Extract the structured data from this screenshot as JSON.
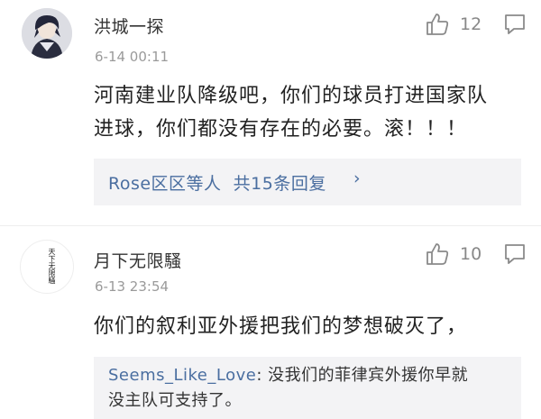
{
  "comments": [
    {
      "username": "洪城一探",
      "timestamp": "6-14 00:11",
      "like_count": "12",
      "text_lines": [
        "河南建业队降级吧，你们的球员打进国家队",
        "进球，你们都没有存在的必要。滚！！！"
      ],
      "replies_summary": "Rose区区等人  共15条回复",
      "replies_chevron": "›"
    },
    {
      "username": "月下无限騷",
      "timestamp": "6-13 23:54",
      "like_count": "10",
      "avatar_text": "天下无限騷",
      "text_lines": [
        "你们的叙利亚外援把我们的梦想破灭了，"
      ],
      "reply": {
        "author": "Seems_Like_Love",
        "separator": ": ",
        "text_line1": "没我们的菲律宾外援你早就",
        "text_line2": "没主队可支持了。"
      }
    }
  ],
  "icons": {
    "like": "thumbs-up-icon",
    "reply": "comment-bubble-icon"
  },
  "colors": {
    "link": "#4a6ea0",
    "muted": "#9a9a9a",
    "reply_bg": "#f3f3f5"
  }
}
